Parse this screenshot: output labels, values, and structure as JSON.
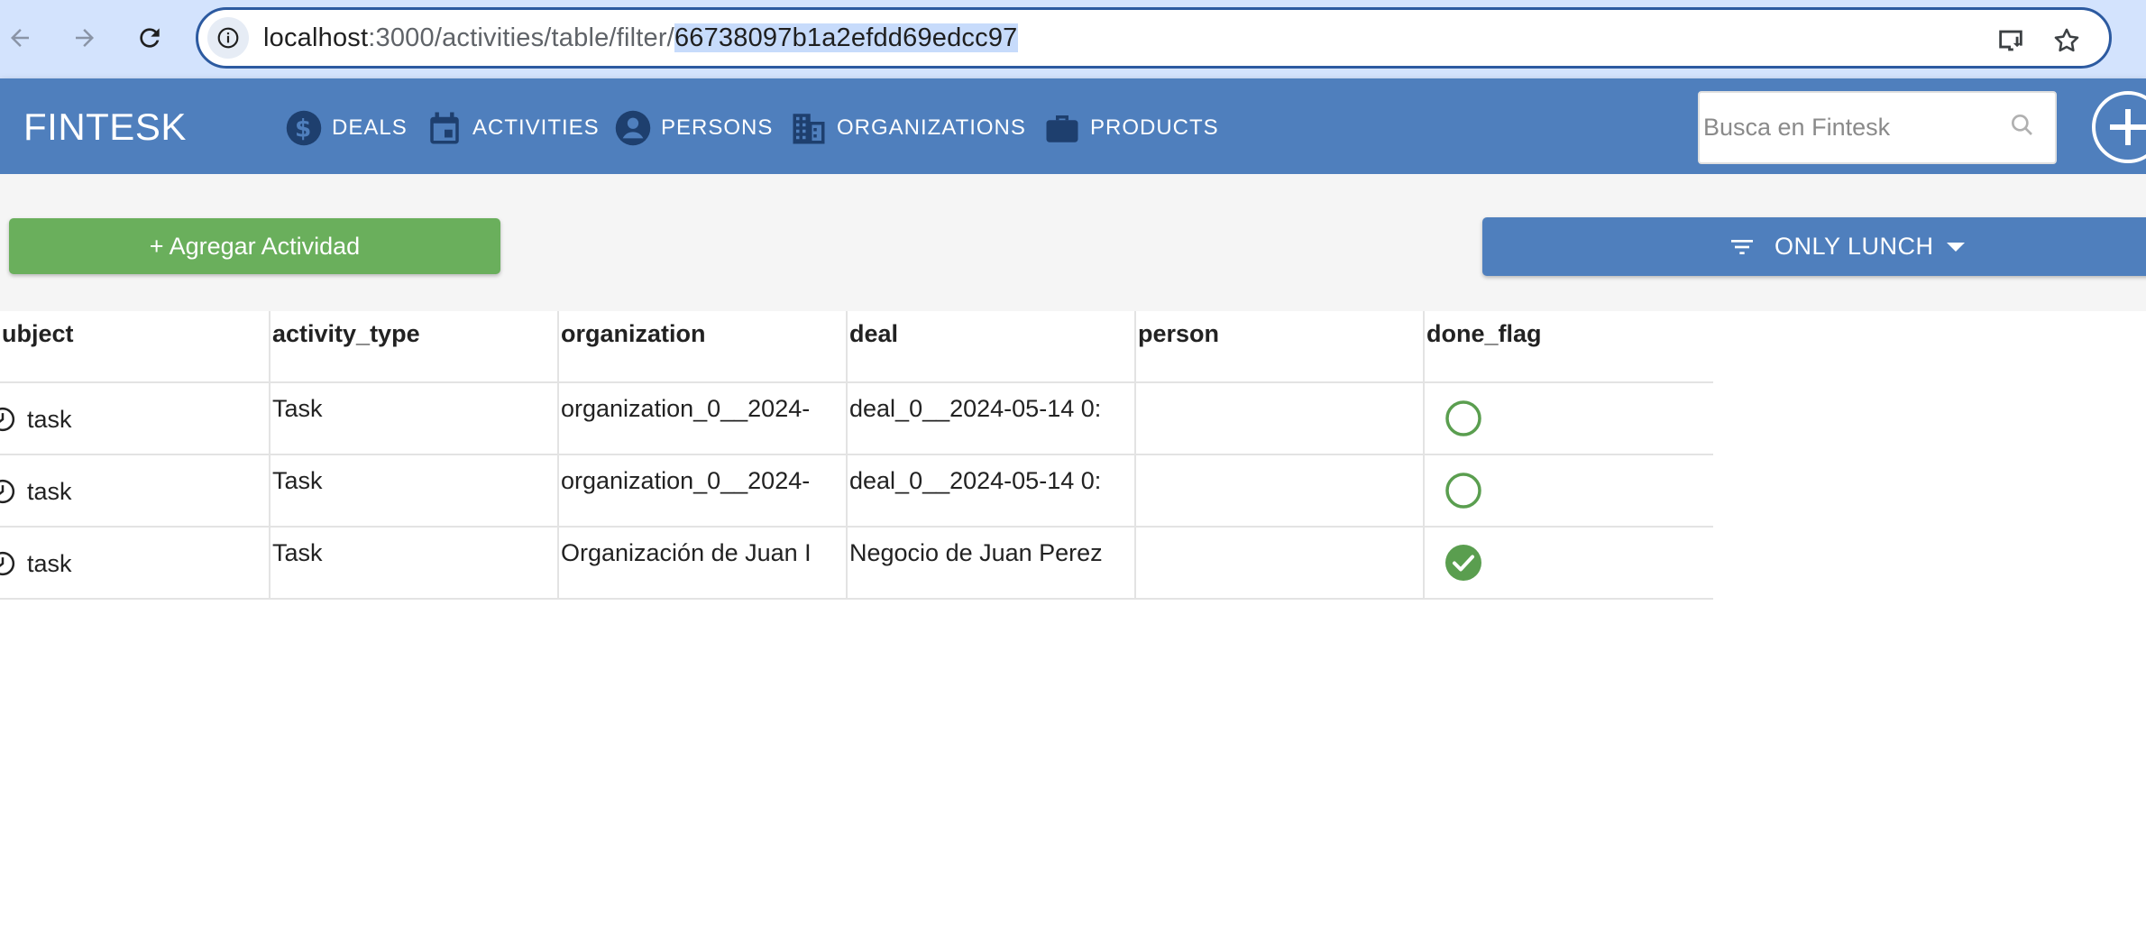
{
  "browser": {
    "url_host": "localhost",
    "url_path_prefix": ":3000/activities/table/filter/",
    "url_selected": "66738097b1a2efdd69edcc97"
  },
  "app": {
    "brand": "FINTESK",
    "nav": [
      {
        "label": "DEALS",
        "icon": "dollar-icon"
      },
      {
        "label": "ACTIVITIES",
        "icon": "calendar-icon"
      },
      {
        "label": "PERSONS",
        "icon": "person-icon"
      },
      {
        "label": "ORGANIZATIONS",
        "icon": "building-icon"
      },
      {
        "label": "PRODUCTS",
        "icon": "briefcase-icon"
      }
    ],
    "search_placeholder": "Busca en Fintesk"
  },
  "toolbar": {
    "add_label": "+ Agregar Actividad",
    "filter_label": "ONLY LUNCH"
  },
  "table": {
    "columns": [
      "ubject",
      "activity_type",
      "organization",
      "deal",
      "person",
      "done_flag"
    ],
    "rows": [
      {
        "subject": "task",
        "activity_type": "Task",
        "organization": "organization_0__2024-",
        "deal": "deal_0__2024-05-14 0:",
        "person": "",
        "done": false
      },
      {
        "subject": "task",
        "activity_type": "Task",
        "organization": "organization_0__2024-",
        "deal": "deal_0__2024-05-14 0:",
        "person": "",
        "done": false
      },
      {
        "subject": "task",
        "activity_type": "Task",
        "organization": "Organización de Juan I",
        "deal": "Negocio de Juan Perez",
        "person": "",
        "done": true
      }
    ]
  },
  "colors": {
    "header_blue": "#4f7fbd",
    "add_green": "#6aaf5c",
    "link_blue": "#3b73c8",
    "done_green": "#5a9e4f"
  }
}
